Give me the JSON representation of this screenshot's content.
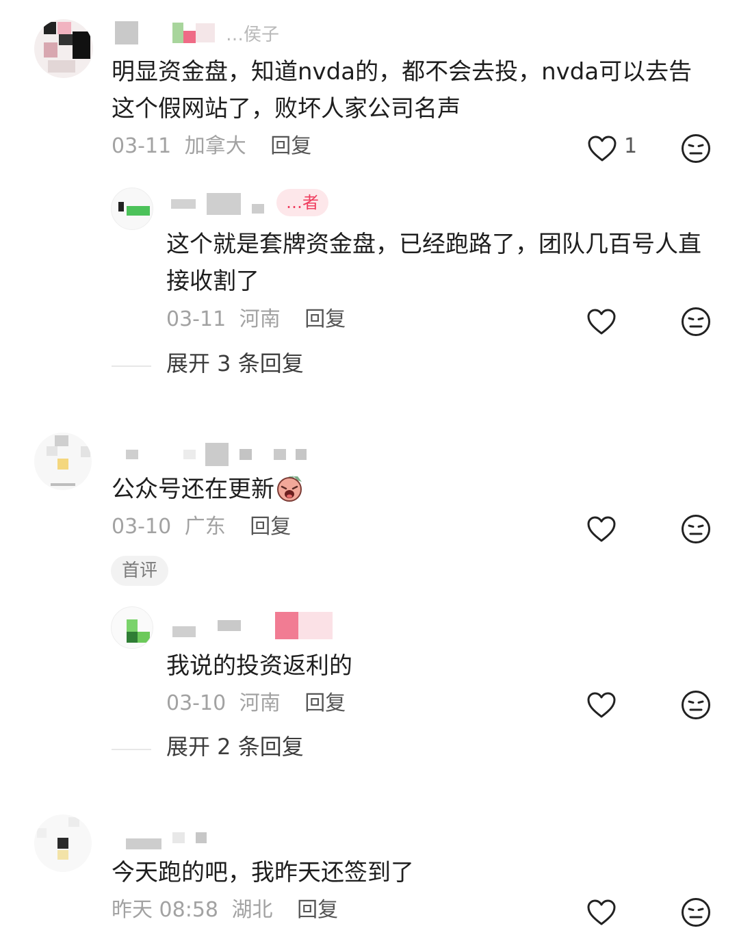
{
  "comments": [
    {
      "name_visible": "…侯子",
      "text": "明显资金盘，知道nvda的，都不会去投，nvda可以去告这个假网站了，败坏人家公司名声",
      "date": "03-11",
      "location": "加拿大",
      "reply_label": "回复",
      "like_count": "1",
      "reply": {
        "author_badge": "…者",
        "text": "这个就是套牌资金盘，已经跑路了，团队几百号人直接收割了",
        "date": "03-11",
        "location": "河南",
        "reply_label": "回复",
        "expand_label": "展开 3 条回复"
      }
    },
    {
      "text": "公众号还在更新",
      "date": "03-10",
      "location": "广东",
      "reply_label": "回复",
      "tag": "首评",
      "reply": {
        "text": "我说的投资返利的",
        "date": "03-10",
        "location": "河南",
        "reply_label": "回复",
        "expand_label": "展开 2 条回复"
      }
    },
    {
      "text": "今天跑的吧，我昨天还签到了",
      "date": "昨天 08:58",
      "location": "湖北",
      "reply_label": "回复"
    }
  ],
  "icons": {
    "like": "heart-outline-icon",
    "dislike": "neutral-face-icon",
    "emoji": "crying-face-emoji"
  },
  "colors": {
    "meta": "#a2a2a2",
    "text": "#1e1e1e",
    "author_badge_bg": "#fde7ea",
    "author_badge_fg": "#ef3d5e"
  }
}
